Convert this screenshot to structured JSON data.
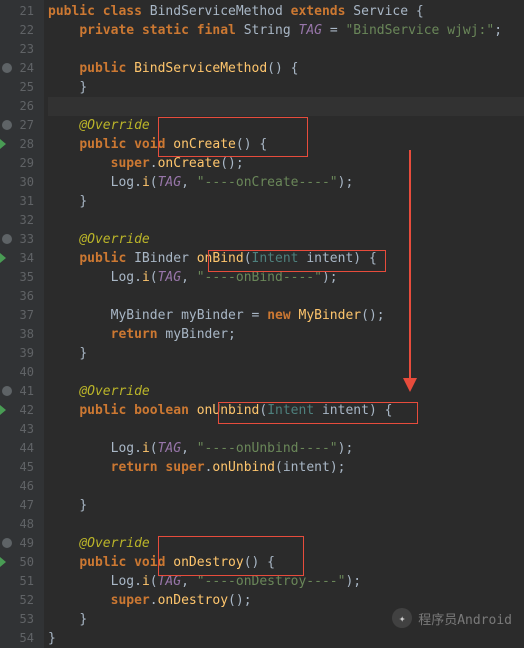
{
  "lines": [
    {
      "n": 21,
      "marker": ""
    },
    {
      "n": 22,
      "marker": ""
    },
    {
      "n": 23,
      "marker": ""
    },
    {
      "n": 24,
      "marker": "circle"
    },
    {
      "n": 25,
      "marker": ""
    },
    {
      "n": 26,
      "marker": ""
    },
    {
      "n": 27,
      "marker": "circle"
    },
    {
      "n": 28,
      "marker": "tri"
    },
    {
      "n": 29,
      "marker": ""
    },
    {
      "n": 30,
      "marker": ""
    },
    {
      "n": 31,
      "marker": ""
    },
    {
      "n": 32,
      "marker": ""
    },
    {
      "n": 33,
      "marker": "circle"
    },
    {
      "n": 34,
      "marker": "tri"
    },
    {
      "n": 35,
      "marker": ""
    },
    {
      "n": 36,
      "marker": ""
    },
    {
      "n": 37,
      "marker": ""
    },
    {
      "n": 38,
      "marker": ""
    },
    {
      "n": 39,
      "marker": ""
    },
    {
      "n": 40,
      "marker": ""
    },
    {
      "n": 41,
      "marker": "circle"
    },
    {
      "n": 42,
      "marker": "tri"
    },
    {
      "n": 43,
      "marker": ""
    },
    {
      "n": 44,
      "marker": ""
    },
    {
      "n": 45,
      "marker": ""
    },
    {
      "n": 46,
      "marker": ""
    },
    {
      "n": 47,
      "marker": ""
    },
    {
      "n": 48,
      "marker": ""
    },
    {
      "n": 49,
      "marker": "circle"
    },
    {
      "n": 50,
      "marker": "tri"
    },
    {
      "n": 51,
      "marker": ""
    },
    {
      "n": 52,
      "marker": ""
    },
    {
      "n": 53,
      "marker": ""
    },
    {
      "n": 54,
      "marker": ""
    }
  ],
  "code": {
    "className": "BindServiceMethod",
    "extends": "Service",
    "tagField": "TAG",
    "tagValue": "\"BindService wjwj:\"",
    "constructor": "BindServiceMethod",
    "override": "@Override",
    "onCreate": "onCreate",
    "superOnCreate": "onCreate",
    "logI": "i",
    "logCls": "Log",
    "onCreateStr": "\"----onCreate----\"",
    "onBind": "onBind",
    "iBinder": "IBinder",
    "intent": "Intent",
    "intentParam": "intent",
    "onBindStr": "\"----onBind----\"",
    "myBinderCls": "MyBinder",
    "myBinderVar": "myBinder",
    "onUnbind": "onUnbind",
    "onUnbindStr": "\"----onUnbind----\"",
    "onDestroy": "onDestroy",
    "onDestroyStr": "\"----onDestroy----\"",
    "kw_public": "public",
    "kw_class": "class",
    "kw_extends": "extends",
    "kw_private": "private",
    "kw_static": "static",
    "kw_final": "final",
    "kw_void": "void",
    "kw_super": "super",
    "kw_new": "new",
    "kw_return": "return",
    "kw_boolean": "boolean",
    "type_String": "String"
  },
  "watermark": "程序员Android"
}
